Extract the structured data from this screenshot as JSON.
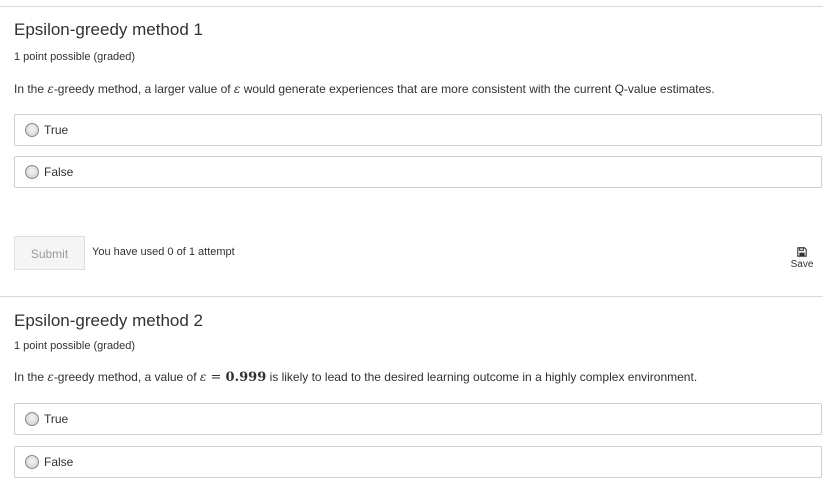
{
  "problems": [
    {
      "title": "Epsilon-greedy method 1",
      "points": "1 point possible (graded)",
      "question": {
        "part1": "In the ",
        "symbol1": "ε",
        "part2": "-greedy method, a larger value of ",
        "symbol2": "ε",
        "part3": " would generate experiences that are more consistent with the current Q-value estimates."
      },
      "options": [
        "True",
        "False"
      ],
      "submit_label": "Submit",
      "attempts_text": "You have used 0 of 1 attempt",
      "save_label": "Save"
    },
    {
      "title": "Epsilon-greedy method 2",
      "points": "1 point possible (graded)",
      "question": {
        "part1": "In the ",
        "symbol1": "ε",
        "part2": "-greedy method, a value of ",
        "symbol2": "ε",
        "equals": " = ",
        "value": "0.999",
        "part3": " is likely to lead to the desired learning outcome in a highly complex environment."
      },
      "options": [
        "True",
        "False"
      ]
    }
  ],
  "icons": {
    "save": "floppy-disk-icon",
    "radio": "radio-unchecked-icon"
  },
  "colors": {
    "text": "#313131",
    "border": "#cfcfcf",
    "submit_text": "#9a9a9a"
  }
}
